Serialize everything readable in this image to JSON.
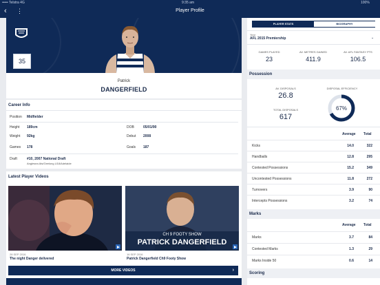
{
  "status": {
    "carrier": "••••• Telstra  4G",
    "time": "9:35 am",
    "battery": "100%"
  },
  "nav": {
    "title": "Player Profile",
    "back_icon": "chevron-left-icon",
    "more_icon": "kebab-icon"
  },
  "hero": {
    "number": "35",
    "club_logo": "geelong-cats-logo"
  },
  "player": {
    "first_name": "Patrick",
    "last_name": "DANGERFIELD"
  },
  "career": {
    "title": "Career Info",
    "position_label": "Position",
    "position": "Midfielder",
    "height_label": "Height",
    "height": "189cm",
    "weight_label": "Weight",
    "weight": "92kg",
    "games_label": "Games",
    "games": "178",
    "dob_label": "DOB",
    "dob": "05/01/90",
    "debut_label": "Debut",
    "debut": "2008",
    "goals_label": "Goals",
    "goals": "187",
    "draft_label": "Draft",
    "draft": "#10, 2007 National Draft",
    "draft_sub": "Anglesea Ats/Geelong U18/Adelaide"
  },
  "videos": {
    "title": "Latest Player Videos",
    "items": [
      {
        "date": "28 SEP 2016",
        "title": "The night Danger delivered"
      },
      {
        "date": "16 SEP 2016",
        "title": "Patrick Dangerfield Ch9 Footy Show",
        "overlay_small": "CH 9 FOOTY SHOW",
        "overlay_big": "PATRICK DANGERFIELD"
      }
    ],
    "more_label": "MORE VIDEOS"
  },
  "stats": {
    "tabs": [
      "PLAYER STATS",
      "BIOGRAPHY"
    ],
    "year_label": "Year",
    "year_value": "AFL 2015 Premiership",
    "summary": [
      {
        "label": "GAMES PLAYED",
        "value": "23"
      },
      {
        "label": "AV. METRES GAINED",
        "value": "411.9"
      },
      {
        "label": "AV. AFL FANTASY PTS",
        "value": "106.5"
      }
    ],
    "possession": {
      "title": "Possession",
      "av_disposals_label": "AV. DISPOSALS",
      "av_disposals": "26.8",
      "total_disposals_label": "TOTAL DISPOSALS",
      "total_disposals": "617",
      "efficiency_label": "DISPOSAL EFFICIENCY",
      "efficiency": "67%",
      "efficiency_fraction": 0.67,
      "columns": [
        "Average",
        "Total"
      ],
      "rows": [
        {
          "label": "Kicks",
          "avg": "14.0",
          "total": "322"
        },
        {
          "label": "Handballs",
          "avg": "12.8",
          "total": "295"
        },
        {
          "label": "Contested Possessions",
          "avg": "15.2",
          "total": "349"
        },
        {
          "label": "Uncontested Possessions",
          "avg": "11.8",
          "total": "272"
        },
        {
          "label": "Turnovers",
          "avg": "3.9",
          "total": "90"
        },
        {
          "label": "Intercepts Possessions",
          "avg": "3.2",
          "total": "74"
        }
      ]
    },
    "marks": {
      "title": "Marks",
      "columns": [
        "Average",
        "Total"
      ],
      "rows": [
        {
          "label": "Marks",
          "avg": "3.7",
          "total": "84"
        },
        {
          "label": "Contested Marks",
          "avg": "1.3",
          "total": "29"
        },
        {
          "label": "Marks Inside 50",
          "avg": "0.6",
          "total": "14"
        }
      ]
    },
    "scoring": {
      "title": "Scoring"
    },
    "accent": "#0f2a57",
    "link_color": "#2a66b8"
  }
}
